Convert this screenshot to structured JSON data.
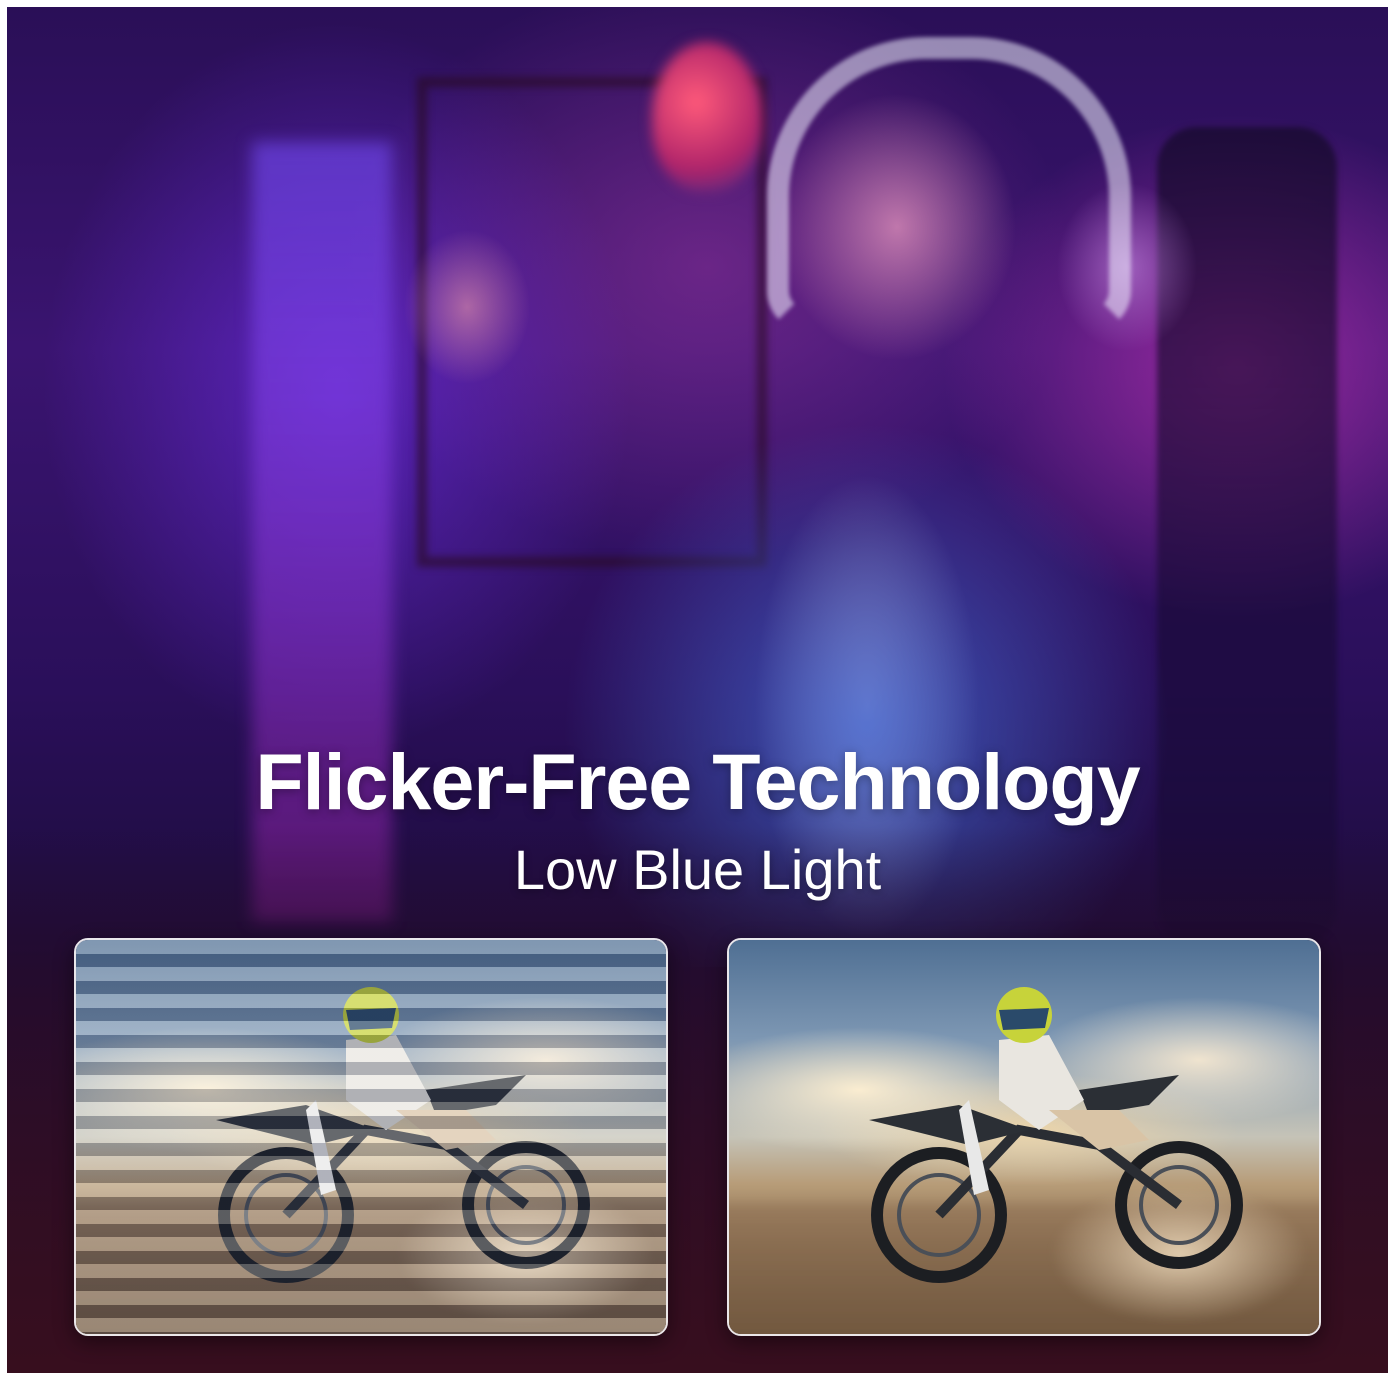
{
  "headline": "Flicker-Free Technology",
  "subheadline": "Low Blue Light",
  "comparison": {
    "left_panel": {
      "icon": "motocross-rider-with-flicker-stripes"
    },
    "right_panel": {
      "icon": "motocross-rider-clear"
    }
  },
  "colors": {
    "text": "#ffffff",
    "background_purple": "#3a1470",
    "panel_border": "#ffffff"
  }
}
